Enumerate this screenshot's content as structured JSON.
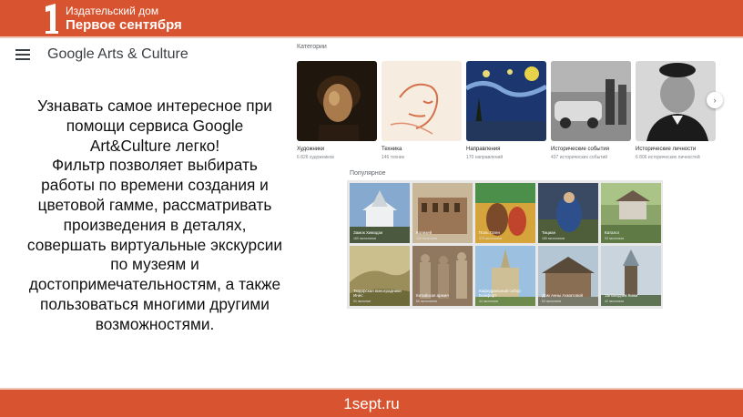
{
  "publisher": {
    "line1": "Издательский дом",
    "line2": "Первое сентября"
  },
  "footer": {
    "site": "1sept.ru"
  },
  "app": {
    "title": "Google Arts & Culture",
    "menu_icon": "hamburger-menu-icon"
  },
  "description": [
    "Узнавать самое интересное при",
    "помощи сервиса Google",
    "Art&Culture легко!",
    "Фильтр позволяет выбирать",
    "работы по времени создания и",
    "цветовой гамме, рассматривать",
    "произведения в деталях,",
    "совершать виртуальные экскурсии",
    "по музеям и",
    "достопримечательностям, а также",
    "пользоваться многими другими",
    "возможностями."
  ],
  "categories": {
    "label": "Категории",
    "items": [
      {
        "name": "Художники",
        "count": "6 826 художников"
      },
      {
        "name": "Техника",
        "count": "146 техник"
      },
      {
        "name": "Направления",
        "count": "170 направлений"
      },
      {
        "name": "Исторические события",
        "count": "437 исторических событий"
      },
      {
        "name": "Исторические личности",
        "count": "6 806 исторических личностей"
      }
    ],
    "next_icon": "chevron-right-icon"
  },
  "popular": {
    "label": "Популярное",
    "items": [
      {
        "name": "Замок Химэдзи",
        "count": "160 экспонатов"
      },
      {
        "name": "Колизей",
        "count": "132 экспоната"
      },
      {
        "name": "Поль Гоген",
        "count": "375 экспонатов"
      },
      {
        "name": "Тициан",
        "count": "180 экспонатов"
      },
      {
        "name": "Каталог",
        "count": "93 экспоната"
      },
      {
        "name": "Тюдорская виноградники Инес",
        "count": "51 экспонат"
      },
      {
        "name": "Китайская армия",
        "count": "80 экспонатов"
      },
      {
        "name": "Кафедральный собор Бомфорт",
        "count": "44 экспоната"
      },
      {
        "name": "Дом Анны Ахматовой",
        "count": "83 экспоната"
      },
      {
        "name": "Заповедник Кижи",
        "count": "42 экспоната"
      }
    ]
  }
}
